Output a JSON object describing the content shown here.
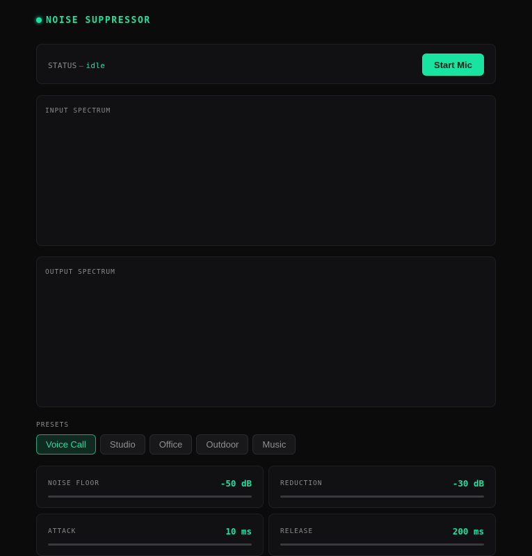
{
  "app": {
    "title": "NOISE SUPPRESSOR",
    "accent_color": "#19e3a0"
  },
  "status": {
    "label": "STATUS",
    "separator": "—",
    "value": "idle",
    "button_label": "Start Mic"
  },
  "spectra": {
    "input_label": "INPUT SPECTRUM",
    "output_label": "OUTPUT SPECTRUM"
  },
  "presets": {
    "label": "PRESETS",
    "items": [
      {
        "label": "Voice Call",
        "active": true
      },
      {
        "label": "Studio",
        "active": false
      },
      {
        "label": "Office",
        "active": false
      },
      {
        "label": "Outdoor",
        "active": false
      },
      {
        "label": "Music",
        "active": false
      }
    ]
  },
  "controls": [
    {
      "label": "NOISE FLOOR",
      "value": "-50 dB"
    },
    {
      "label": "REDUCTION",
      "value": "-30 dB"
    },
    {
      "label": "ATTACK",
      "value": "10 ms"
    },
    {
      "label": "RELEASE",
      "value": "200 ms"
    }
  ]
}
